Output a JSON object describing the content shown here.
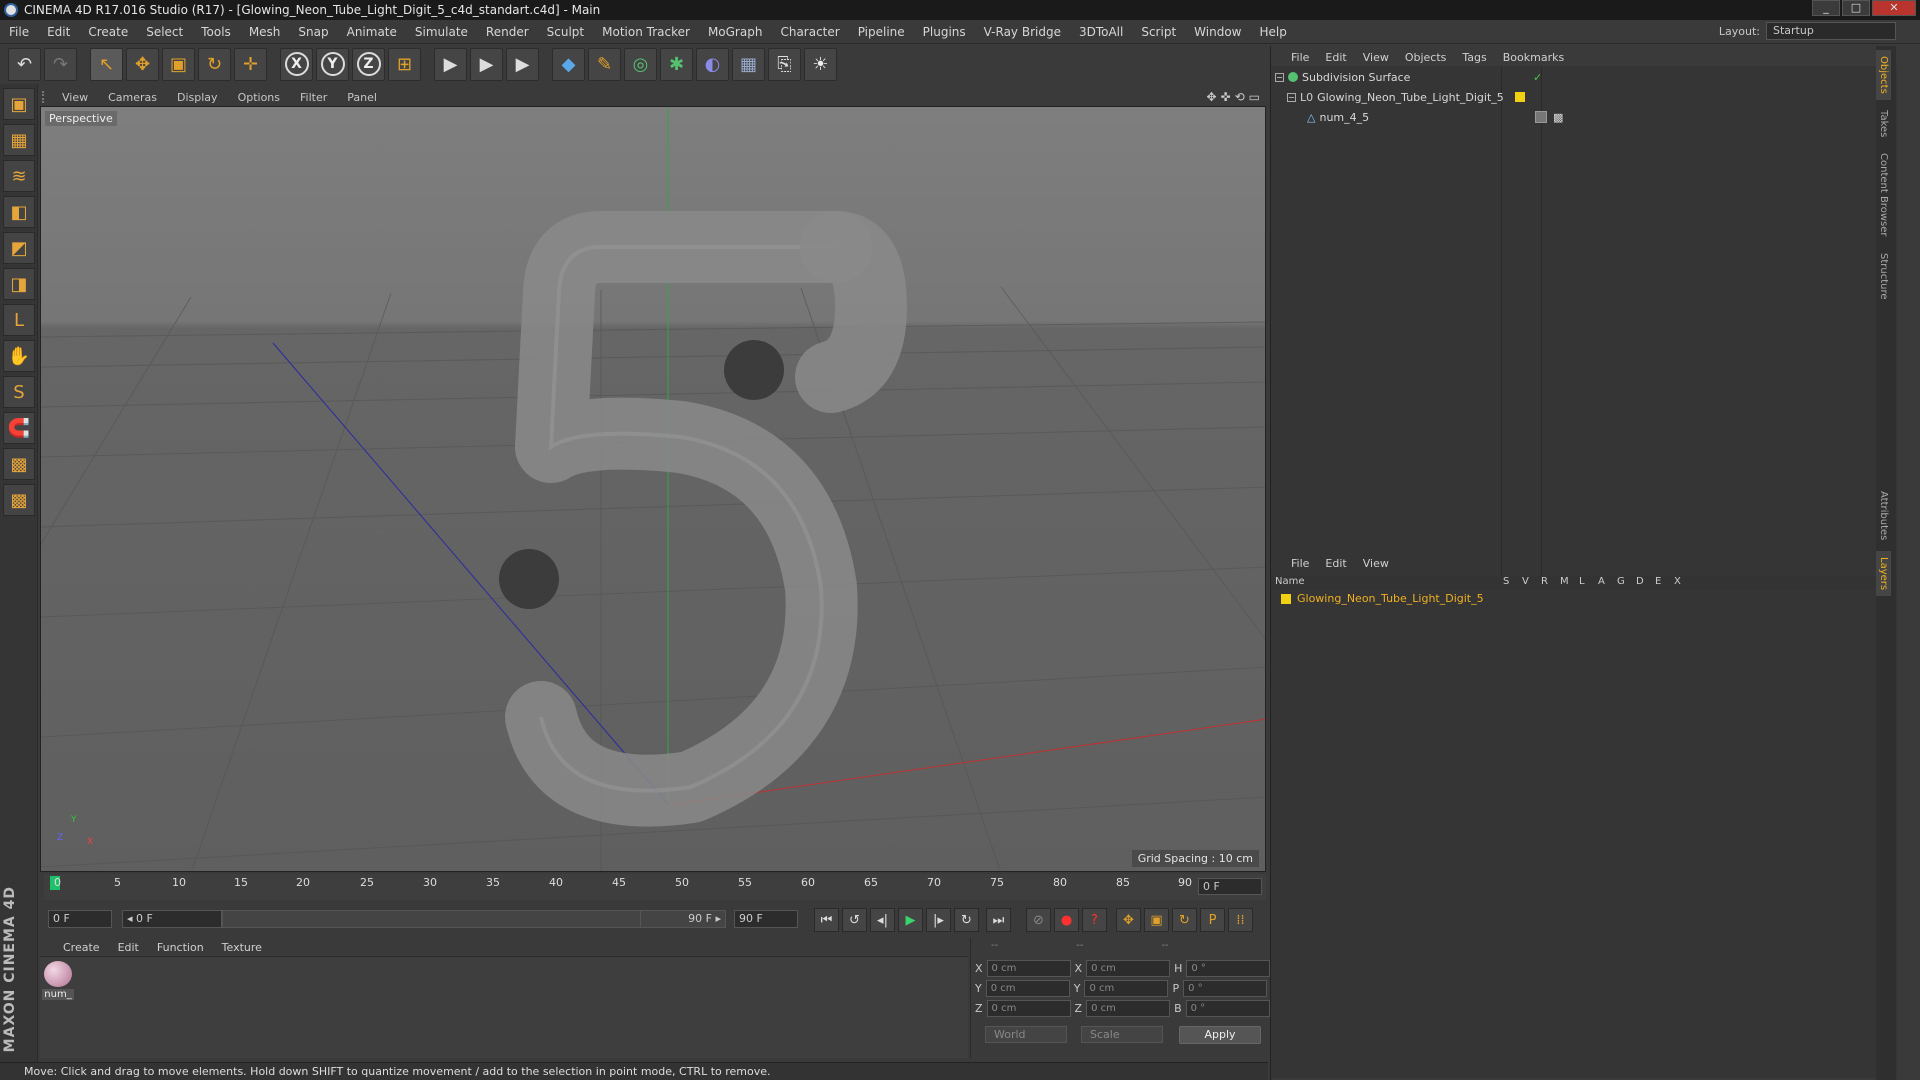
{
  "window": {
    "title": "CINEMA 4D R17.016 Studio (R17) - [Glowing_Neon_Tube_Light_Digit_5_c4d_standart.c4d] - Main",
    "minimize": "_",
    "maximize": "□",
    "close": "✕"
  },
  "menu": [
    "File",
    "Edit",
    "Create",
    "Select",
    "Tools",
    "Mesh",
    "Snap",
    "Animate",
    "Simulate",
    "Render",
    "Sculpt",
    "Motion Tracker",
    "MoGraph",
    "Character",
    "Pipeline",
    "Plugins",
    "V-Ray Bridge",
    "3DToAll",
    "Script",
    "Window",
    "Help"
  ],
  "layout": {
    "label": "Layout:",
    "value": "Startup"
  },
  "toolbar": {
    "undo": "↶",
    "redo": "↷",
    "select": "↖",
    "move": "✥",
    "scale": "▣",
    "rotate": "↻",
    "add": "✛",
    "x": "X",
    "y": "Y",
    "z": "Z",
    "coord": "⊞",
    "render1": "▶",
    "render2": "▶",
    "render3": "▶",
    "cube": "◆",
    "pen": "✎",
    "nurbs": "◎",
    "array": "✱",
    "deform": "◐",
    "floor": "▦",
    "camera": "⎘",
    "light": "☀"
  },
  "leftbar": [
    "▣",
    "▦",
    "≋",
    "◧",
    "◩",
    "◨",
    "L",
    "✋",
    "S",
    "🧲",
    "▩",
    "▩"
  ],
  "maxon": "MAXON CINEMA 4D",
  "viewport": {
    "menu": [
      "View",
      "Cameras",
      "Display",
      "Options",
      "Filter",
      "Panel"
    ],
    "corner_icons": [
      "✥",
      "✜",
      "⟲",
      "▭"
    ],
    "label": "Perspective",
    "grid_spacing": "Grid Spacing : 10 cm",
    "axis_x": "X",
    "axis_y": "Y",
    "axis_z": "Z"
  },
  "timeline": {
    "ticks": [
      "0",
      "5",
      "10",
      "15",
      "20",
      "25",
      "30",
      "35",
      "40",
      "45",
      "50",
      "55",
      "60",
      "65",
      "70",
      "75",
      "80",
      "85",
      "90"
    ],
    "frame_end": "0 F"
  },
  "transport": {
    "start": "0 F",
    "range_start": "◂ 0 F",
    "range_end": "90 F ▸",
    "end": "90 F",
    "buttons": [
      "⏮",
      "↺",
      "◂|",
      "▶",
      "|▸",
      "↻",
      "⏭",
      "⊘",
      "●",
      "?",
      "✥",
      "▣",
      "↻",
      "P",
      "⁞⁞",
      "▤"
    ]
  },
  "materials": {
    "menu": [
      "Create",
      "Edit",
      "Function",
      "Texture"
    ],
    "items": [
      {
        "name": "num_"
      }
    ]
  },
  "coordinates": {
    "header": [
      "--",
      "--",
      "--"
    ],
    "rows": [
      {
        "l1": "X",
        "v1": "0 cm",
        "l2": "X",
        "v2": "0 cm",
        "l3": "H",
        "v3": "0 °"
      },
      {
        "l1": "Y",
        "v1": "0 cm",
        "l2": "Y",
        "v2": "0 cm",
        "l3": "P",
        "v3": "0 °"
      },
      {
        "l1": "Z",
        "v1": "0 cm",
        "l2": "Z",
        "v2": "0 cm",
        "l3": "B",
        "v3": "0 °"
      }
    ],
    "mode1": "World",
    "mode2": "Scale",
    "apply": "Apply"
  },
  "status": "Move: Click and drag to move elements. Hold down SHIFT to quantize movement / add to the selection in point mode, CTRL to remove.",
  "objects": {
    "menu": [
      "File",
      "Edit",
      "View",
      "Objects",
      "Tags",
      "Bookmarks"
    ],
    "rows": [
      {
        "name": "Subdivision Surface",
        "check": "✓"
      },
      {
        "name": "Glowing_Neon_Tube_Light_Digit_5"
      },
      {
        "name": "num_4_5"
      }
    ]
  },
  "layers": {
    "menu": [
      "File",
      "Edit",
      "View"
    ],
    "columns": [
      "Name",
      "S",
      "V",
      "R",
      "M",
      "L",
      "A",
      "G",
      "D",
      "E",
      "X"
    ],
    "rows": [
      {
        "name": "Glowing_Neon_Tube_Light_Digit_5"
      }
    ]
  },
  "side_tabs": [
    "Objects",
    "Takes",
    "Content Browser",
    "Structure",
    "Attributes",
    "Layers"
  ]
}
